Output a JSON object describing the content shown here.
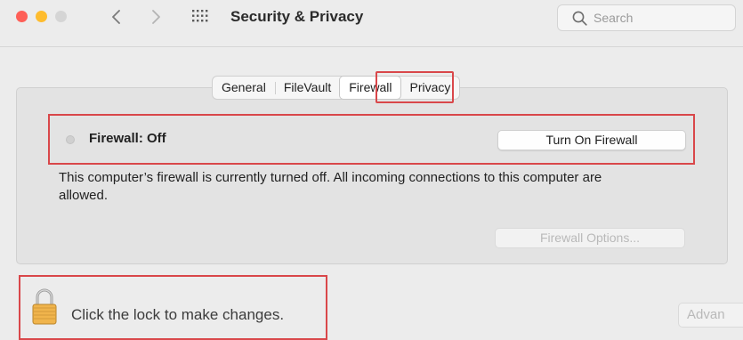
{
  "window": {
    "title": "Security & Privacy",
    "traffic_lights": {
      "close": "#fe5f57",
      "minimize": "#febc2e",
      "maximize": "#d5d5d5"
    }
  },
  "toolbar": {
    "back_icon": "chevron-left-icon",
    "forward_icon": "chevron-right-icon",
    "show_all_icon": "grid-icon",
    "search": {
      "placeholder": "Search",
      "value": "",
      "icon": "search-icon"
    }
  },
  "tabs": [
    {
      "label": "General",
      "selected": false
    },
    {
      "label": "FileVault",
      "selected": false
    },
    {
      "label": "Firewall",
      "selected": true
    },
    {
      "label": "Privacy",
      "selected": false
    }
  ],
  "firewall": {
    "status_label": "Firewall: Off",
    "status_indicator": "grey",
    "turn_on_button": "Turn On Firewall",
    "description": "This computer’s firewall is currently turned off. All incoming connections to this computer are allowed.",
    "options_button": "Firewall Options...",
    "options_enabled": false
  },
  "footer": {
    "lock_icon": "lock-icon",
    "lock_text": "Click the lock to make changes.",
    "advanced_button": "Advan"
  },
  "annotations": {
    "highlight_color": "#d9474a"
  }
}
